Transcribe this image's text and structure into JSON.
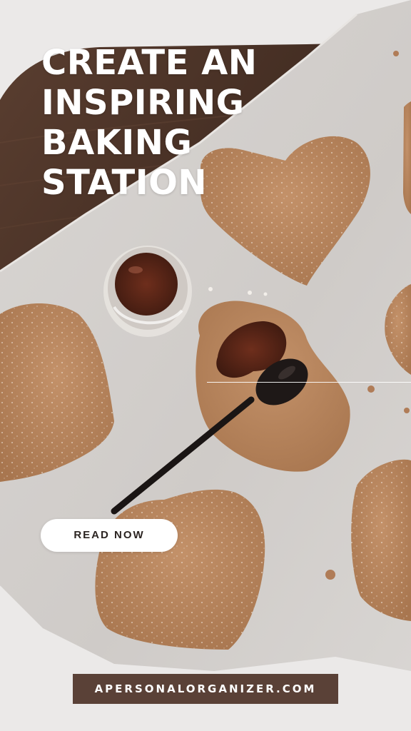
{
  "pin": {
    "headline": "CREATE AN\nINSPIRING\nBAKING\nSTATION",
    "button_label": "READ NOW",
    "site_url": "APERSONALORGANIZER.COM"
  },
  "colors": {
    "headline_text": "#ffffff",
    "button_bg": "#ffffff",
    "button_text": "#2b2421",
    "url_bar_bg": "#5a4137",
    "url_bar_text": "#ffffff",
    "board": "#4b3327",
    "parchment": "#dcd9d6",
    "cookie": "#b98661"
  }
}
